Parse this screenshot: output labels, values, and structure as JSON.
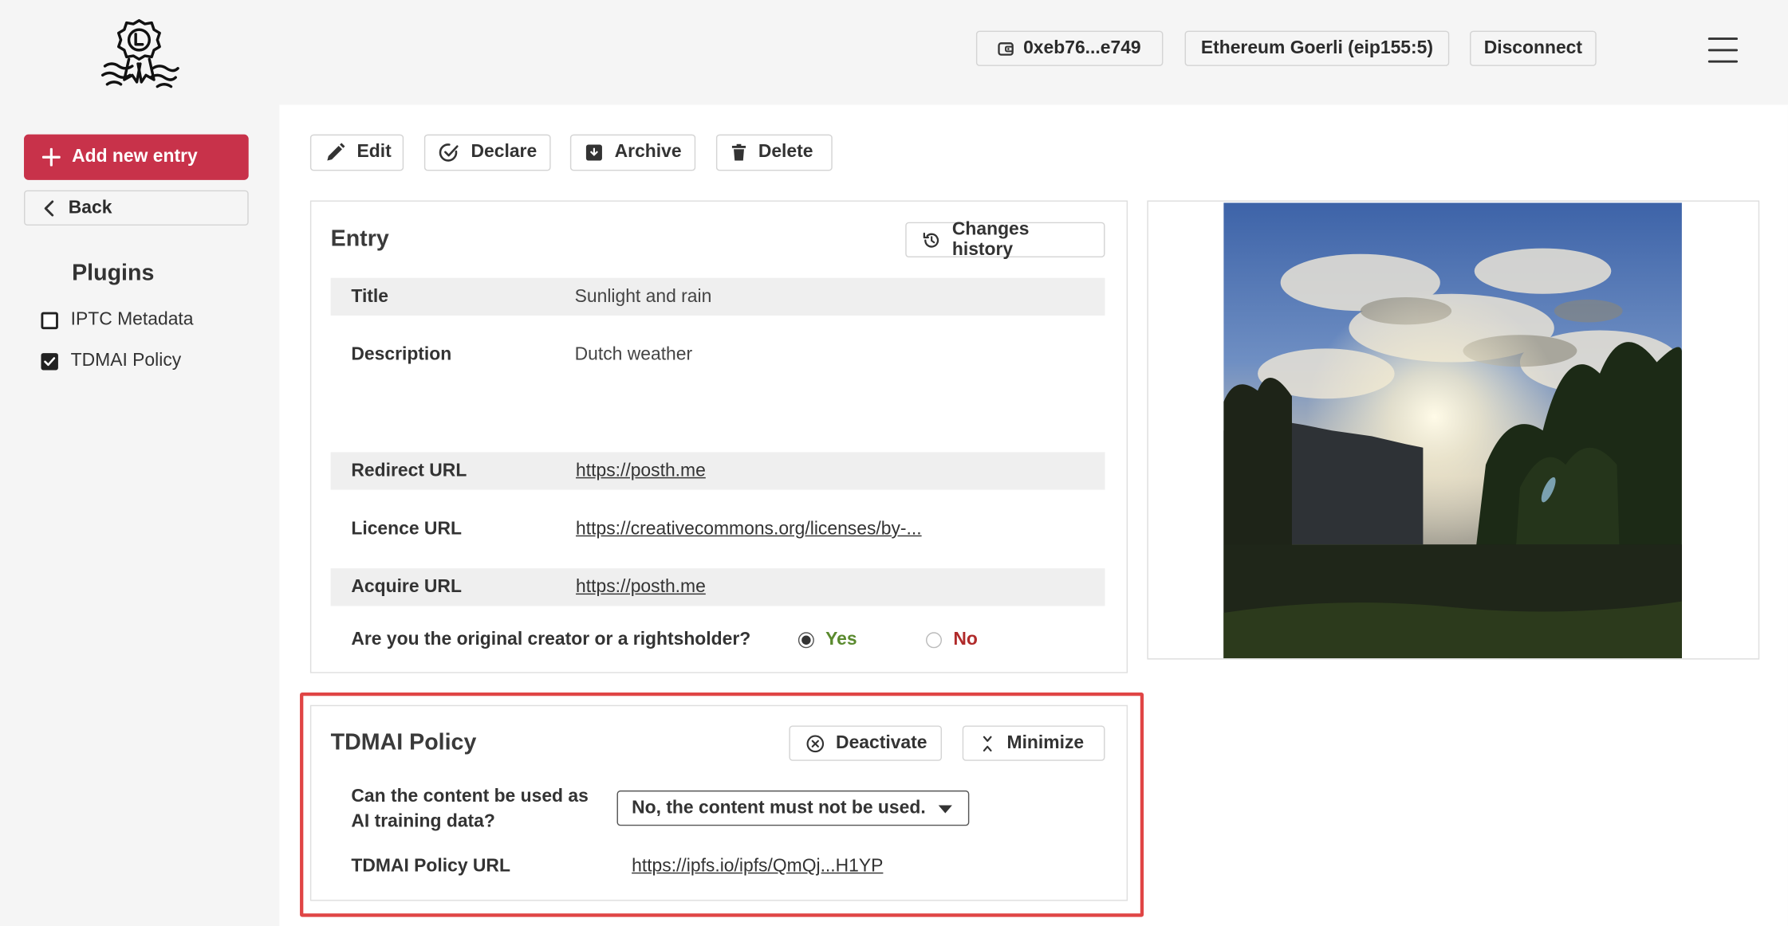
{
  "header": {
    "wallet_address": "0xeb76...e749",
    "network": "Ethereum Goerli (eip155:5)",
    "disconnect_label": "Disconnect"
  },
  "sidebar": {
    "add_new_label": "Add new entry",
    "back_label": "Back",
    "plugins_heading": "Plugins",
    "plugins": [
      {
        "label": "IPTC Metadata",
        "checked": false
      },
      {
        "label": "TDMAI Policy",
        "checked": true
      }
    ]
  },
  "toolbar": {
    "edit_label": "Edit",
    "declare_label": "Declare",
    "archive_label": "Archive",
    "delete_label": "Delete"
  },
  "entry": {
    "heading": "Entry",
    "history_label": "Changes history",
    "fields": {
      "title_label": "Title",
      "title_value": "Sunlight and rain",
      "description_label": "Description",
      "description_value": "Dutch weather",
      "redirect_label": "Redirect URL",
      "redirect_value": "https://posth.me",
      "licence_label": "Licence URL",
      "licence_value": "https://creativecommons.org/licenses/by-...",
      "acquire_label": "Acquire URL",
      "acquire_value": "https://posth.me"
    },
    "creator_question": "Are you the original creator or a rightsholder?",
    "yes_label": "Yes",
    "no_label": "No",
    "selected": "Yes",
    "colors": {
      "yes": "#5a8a2e",
      "no": "#b02a2a"
    }
  },
  "tdmai": {
    "heading": "TDMAI Policy",
    "deactivate_label": "Deactivate",
    "minimize_label": "Minimize",
    "question": "Can the content be used as AI training data?",
    "question_line1": "Can the content be used as",
    "question_line2": "AI training data?",
    "selected_option": "No, the content must not be used.",
    "policy_url_label": "TDMAI Policy URL",
    "policy_url_value": "https://ipfs.io/ipfs/QmQj...H1YP"
  },
  "colors": {
    "brand": "#c8324a",
    "highlight": "#e04545"
  },
  "icons": [
    "logo-seal-icon",
    "wallet-icon",
    "menu-icon",
    "plus-icon",
    "chevron-left-icon",
    "pencil-icon",
    "declare-check-icon",
    "archive-icon",
    "trash-icon",
    "history-icon",
    "close-circle-icon",
    "minimize-icon",
    "caret-down-icon"
  ]
}
